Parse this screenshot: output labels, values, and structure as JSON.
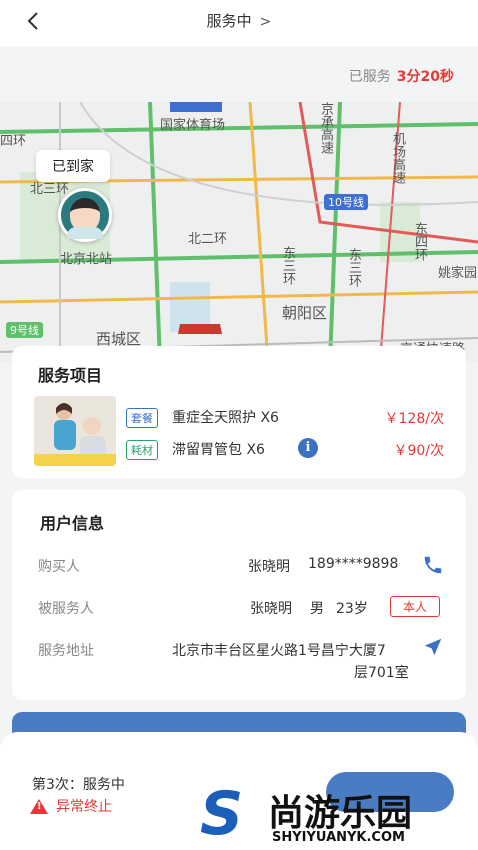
{
  "header": {
    "title": "服务中",
    "back_icon": "chevron-left-icon",
    "title_chevron": "chevron-right-icon"
  },
  "elapsed": {
    "label": "已服务",
    "value": "3分20秒"
  },
  "map": {
    "marker_label": "已到家",
    "labels": [
      "国家体育场",
      "四环",
      "北三环",
      "北二环",
      "北京北站",
      "西城区",
      "朝阳区",
      "10号线",
      "9号线",
      "东三环",
      "东四环",
      "姚家园",
      "东三环",
      "京通快速路"
    ],
    "road_labels": [
      "京承高速",
      "机场高速"
    ]
  },
  "service_items": {
    "heading": "服务项目",
    "items": [
      {
        "tag": "套餐",
        "name": "重症全天照护 X6",
        "price": "￥128/次",
        "tag_color": "#3b72c4"
      },
      {
        "tag": "耗材",
        "name": "滞留胃管包 X6",
        "price": "￥90/次",
        "tag_color": "#2ca36b",
        "info": "i"
      }
    ]
  },
  "user_info": {
    "heading": "用户信息",
    "buyer": {
      "label": "购买人",
      "name": "张晓明",
      "phone": "189****9898"
    },
    "served": {
      "label": "被服务人",
      "name": "张晓明",
      "gender": "男",
      "age": "23岁",
      "badge": "本人"
    },
    "address": {
      "label": "服务地址",
      "line1": "北京市丰台区星火路1号昌宁大厦7",
      "line2": "层701室"
    }
  },
  "bottom": {
    "status": "第3次：服务中",
    "abnormal": "异常终止"
  },
  "watermark": {
    "logo": "S",
    "text": "尚游乐园",
    "sub": "SHYIYUANYK.COM"
  },
  "colors": {
    "accent": "#4a7cc4",
    "danger": "#e53935",
    "green": "#2ca36b"
  }
}
